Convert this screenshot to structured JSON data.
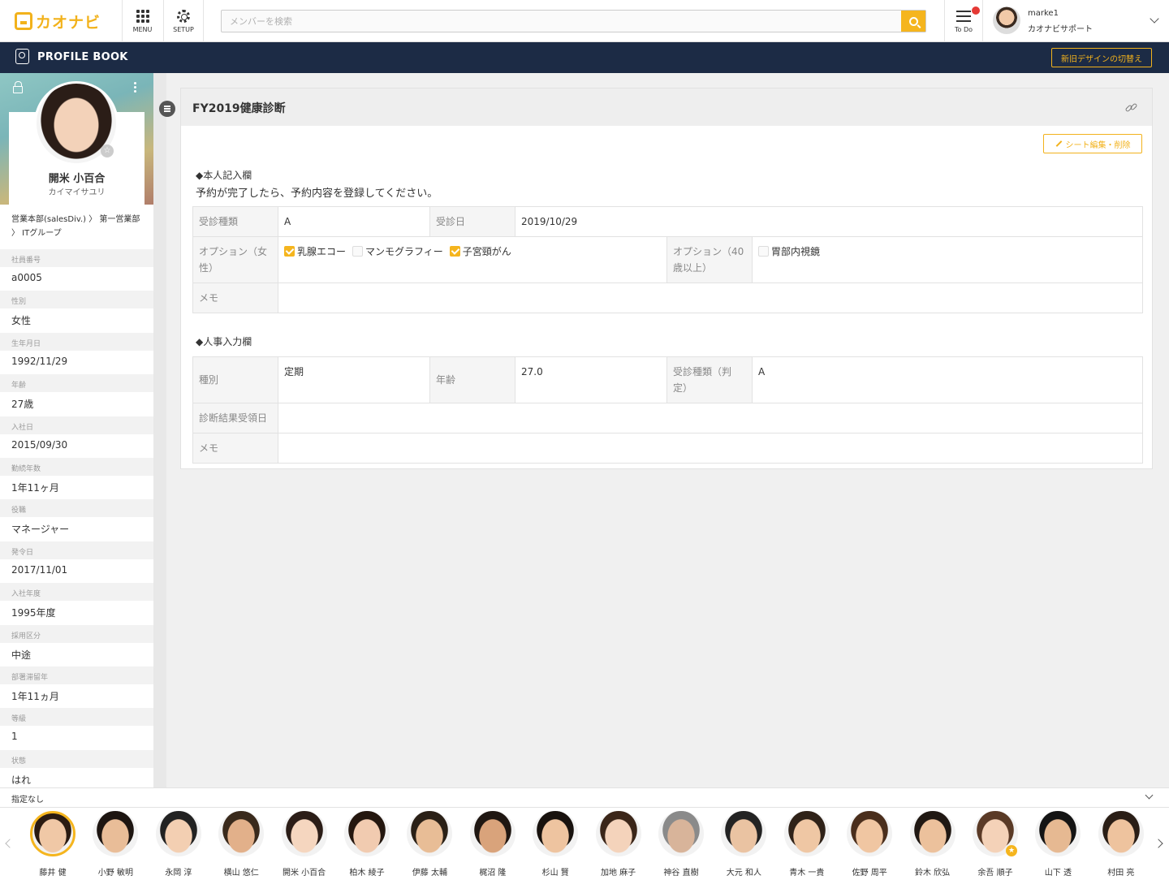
{
  "app": {
    "logo_text": "カオナビ",
    "menu_label": "MENU",
    "setup_label": "SETUP",
    "todo_label": "To Do",
    "search_placeholder": "メンバーを検索",
    "user": {
      "name": "marke1",
      "org": "カオナビサポート"
    },
    "accent_color": "#f5b51e",
    "header_color": "#1c2b45"
  },
  "titlebar": {
    "title": "PROFILE BOOK",
    "switch_design_button": "新旧デザインの切替え"
  },
  "profile": {
    "name": "開米 小百合",
    "kana": "カイマイサユリ",
    "department": "営業本部(salesDiv.) 〉 第一営業部 〉 ITグループ",
    "fields": [
      {
        "label": "社員番号",
        "value": "a0005"
      },
      {
        "label": "性別",
        "value": "女性"
      },
      {
        "label": "生年月日",
        "value": "1992/11/29"
      },
      {
        "label": "年齢",
        "value": "27歳"
      },
      {
        "label": "入社日",
        "value": "2015/09/30"
      },
      {
        "label": "勤続年数",
        "value": "1年11ヶ月"
      },
      {
        "label": "役職",
        "value": "マネージャー"
      },
      {
        "label": "発令日",
        "value": "2017/11/01"
      },
      {
        "label": "入社年度",
        "value": "1995年度"
      },
      {
        "label": "採用区分",
        "value": "中途"
      },
      {
        "label": "部署滞留年",
        "value": "1年11ヵ月"
      },
      {
        "label": "等級",
        "value": "1"
      },
      {
        "label": "状態",
        "value": "はれ"
      }
    ]
  },
  "sheet": {
    "title": "FY2019健康診断",
    "edit_button": "シート編集・削除",
    "section1": {
      "title": "◆本人記入欄",
      "note": "予約が完了したら、予約内容を登録してください。",
      "exam_type_label": "受診種類",
      "exam_type_value": "A",
      "exam_date_label": "受診日",
      "exam_date_value": "2019/10/29",
      "option_female_label": "オプション（女性）",
      "option_female_items": [
        {
          "label": "乳腺エコー",
          "checked": true
        },
        {
          "label": "マンモグラフィー",
          "checked": false
        },
        {
          "label": "子宮頸がん",
          "checked": true
        }
      ],
      "option_40_label": "オプション（40歳以上）",
      "option_40_items": [
        {
          "label": "胃部内視鏡",
          "checked": false
        }
      ],
      "memo_label": "メモ",
      "memo_value": ""
    },
    "section2": {
      "title": "◆人事入力欄",
      "kind_label": "種別",
      "kind_value": "定期",
      "age_label": "年齢",
      "age_value": "27.0",
      "judge_label": "受診種類（判定）",
      "judge_value": "A",
      "result_date_label": "診断結果受領日",
      "result_date_value": "",
      "memo_label": "メモ",
      "memo_value": ""
    }
  },
  "filter": {
    "label": "指定なし"
  },
  "members": [
    {
      "name": "藤井 健",
      "selected": true,
      "favorite": false
    },
    {
      "name": "小野 敏明",
      "selected": false,
      "favorite": false
    },
    {
      "name": "永岡 淳",
      "selected": false,
      "favorite": false
    },
    {
      "name": "横山 悠仁",
      "selected": false,
      "favorite": false
    },
    {
      "name": "開米 小百合",
      "selected": false,
      "favorite": false
    },
    {
      "name": "柏木 綾子",
      "selected": false,
      "favorite": false
    },
    {
      "name": "伊藤 太輔",
      "selected": false,
      "favorite": false
    },
    {
      "name": "梶沼 隆",
      "selected": false,
      "favorite": false
    },
    {
      "name": "杉山 賢",
      "selected": false,
      "favorite": false
    },
    {
      "name": "加地 麻子",
      "selected": false,
      "favorite": false
    },
    {
      "name": "神谷 直樹",
      "selected": false,
      "favorite": false
    },
    {
      "name": "大元 和人",
      "selected": false,
      "favorite": false
    },
    {
      "name": "青木 一貴",
      "selected": false,
      "favorite": false
    },
    {
      "name": "佐野 周平",
      "selected": false,
      "favorite": false
    },
    {
      "name": "鈴木 欣弘",
      "selected": false,
      "favorite": false
    },
    {
      "name": "余吾 順子",
      "selected": false,
      "favorite": true
    },
    {
      "name": "山下 透",
      "selected": false,
      "favorite": false
    },
    {
      "name": "村田 亮",
      "selected": false,
      "favorite": false
    }
  ]
}
